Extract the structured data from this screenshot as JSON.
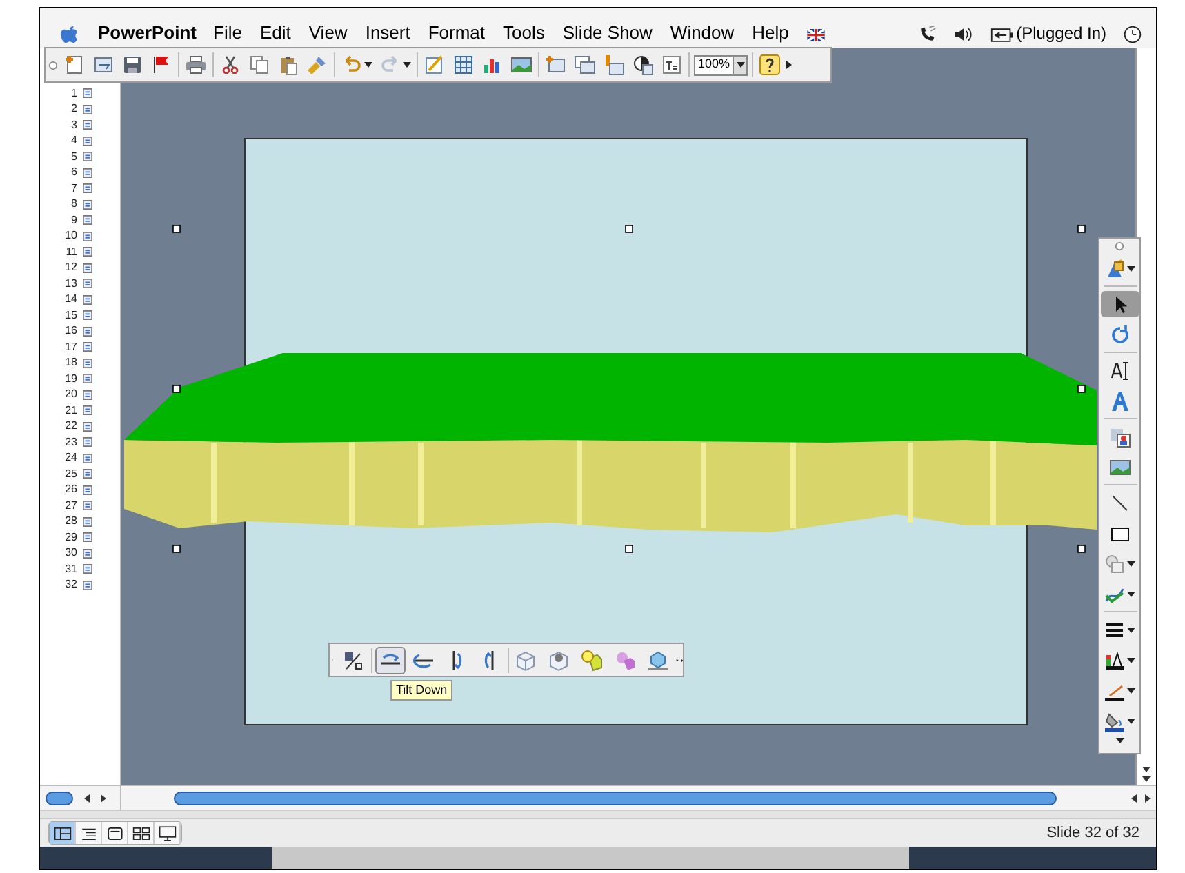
{
  "menu_bar": {
    "app_name": "PowerPoint",
    "menus": [
      "File",
      "Edit",
      "View",
      "Insert",
      "Format",
      "Tools",
      "Slide Show",
      "Window",
      "Help"
    ],
    "battery_status": "(Plugged In)"
  },
  "standard_toolbar": {
    "zoom": "100%"
  },
  "outline": {
    "slide_numbers": [
      "1",
      "2",
      "3",
      "4",
      "5",
      "6",
      "7",
      "8",
      "9",
      "10",
      "11",
      "12",
      "13",
      "14",
      "15",
      "16",
      "17",
      "18",
      "19",
      "20",
      "21",
      "22",
      "23",
      "24",
      "25",
      "26",
      "27",
      "28",
      "29",
      "30",
      "31",
      "32"
    ]
  },
  "three_d_toolbar": {
    "tools": [
      {
        "kind": "toggle",
        "selected": false
      },
      {
        "kind": "tilt-down",
        "selected": true
      },
      {
        "kind": "tilt-up",
        "selected": false
      },
      {
        "kind": "tilt-left",
        "selected": false
      },
      {
        "kind": "tilt-right",
        "selected": false
      },
      {
        "kind": "depth",
        "selected": false
      },
      {
        "kind": "direction",
        "selected": false
      },
      {
        "kind": "lighting",
        "selected": false
      },
      {
        "kind": "surface",
        "selected": false
      },
      {
        "kind": "color",
        "selected": false
      }
    ],
    "tooltip": "Tilt Down"
  },
  "drawing_toolbar": {
    "tools": [
      {
        "kind": "draw-3d",
        "selected": false
      },
      {
        "kind": "pointer",
        "selected": true
      },
      {
        "kind": "rotate",
        "selected": false
      },
      {
        "kind": "text-box",
        "selected": false
      },
      {
        "kind": "wordart",
        "selected": false
      },
      {
        "kind": "clipart",
        "selected": false
      },
      {
        "kind": "picture",
        "selected": false
      },
      {
        "kind": "line",
        "selected": false
      },
      {
        "kind": "rectangle",
        "selected": false
      },
      {
        "kind": "autoshapes",
        "selected": false
      },
      {
        "kind": "connector",
        "selected": false
      },
      {
        "kind": "line-style",
        "selected": false
      },
      {
        "kind": "shadow",
        "selected": false
      },
      {
        "kind": "line-color",
        "selected": false
      },
      {
        "kind": "fill-color",
        "selected": false
      }
    ]
  },
  "view_buttons": [
    {
      "kind": "normal",
      "selected": true
    },
    {
      "kind": "outline",
      "selected": false
    },
    {
      "kind": "slide",
      "selected": false
    },
    {
      "kind": "sorter",
      "selected": false
    },
    {
      "kind": "show",
      "selected": false
    }
  ],
  "status_bar": {
    "text": "Slide 32 of 32"
  }
}
